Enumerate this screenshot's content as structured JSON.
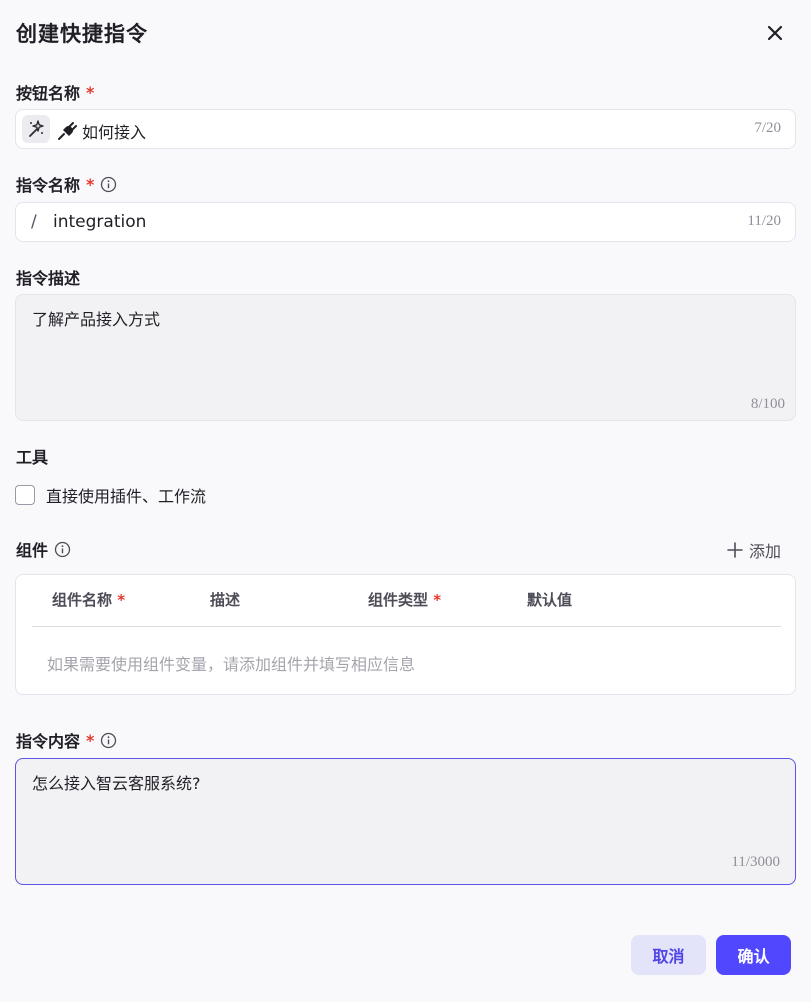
{
  "dialog": {
    "title": "创建快捷指令"
  },
  "button_name": {
    "label": "按钮名称",
    "required_mark": "*",
    "value": "如何接入",
    "counter": "7/20"
  },
  "command_name": {
    "label": "指令名称",
    "required_mark": "*",
    "prefix": "/",
    "value": "integration",
    "counter": "11/20"
  },
  "command_description": {
    "label": "指令描述",
    "value": "了解产品接入方式",
    "counter": "8/100"
  },
  "tools": {
    "label": "工具",
    "checkbox_label": "直接使用插件、工作流",
    "checked": false
  },
  "components": {
    "label": "组件",
    "add_label": "添加",
    "columns": [
      {
        "label": "组件名称",
        "required": "*"
      },
      {
        "label": "描述"
      },
      {
        "label": "组件类型",
        "required": "*"
      },
      {
        "label": "默认值"
      }
    ],
    "empty_text": "如果需要使用组件变量，请添加组件并填写相应信息"
  },
  "command_content": {
    "label": "指令内容",
    "required_mark": "*",
    "value": "怎么接入智云客服系统?",
    "counter": "11/3000"
  },
  "footer": {
    "cancel_label": "取消",
    "confirm_label": "确认"
  },
  "colors": {
    "accent": "#5147ff",
    "required": "#e5382d",
    "focus_border": "#5a55e3"
  },
  "icons": {
    "close": "close-icon",
    "emoji_picker": "sparkle-icon",
    "button_emoji": "plug-icon",
    "info": "info-icon",
    "add": "plus-icon"
  }
}
